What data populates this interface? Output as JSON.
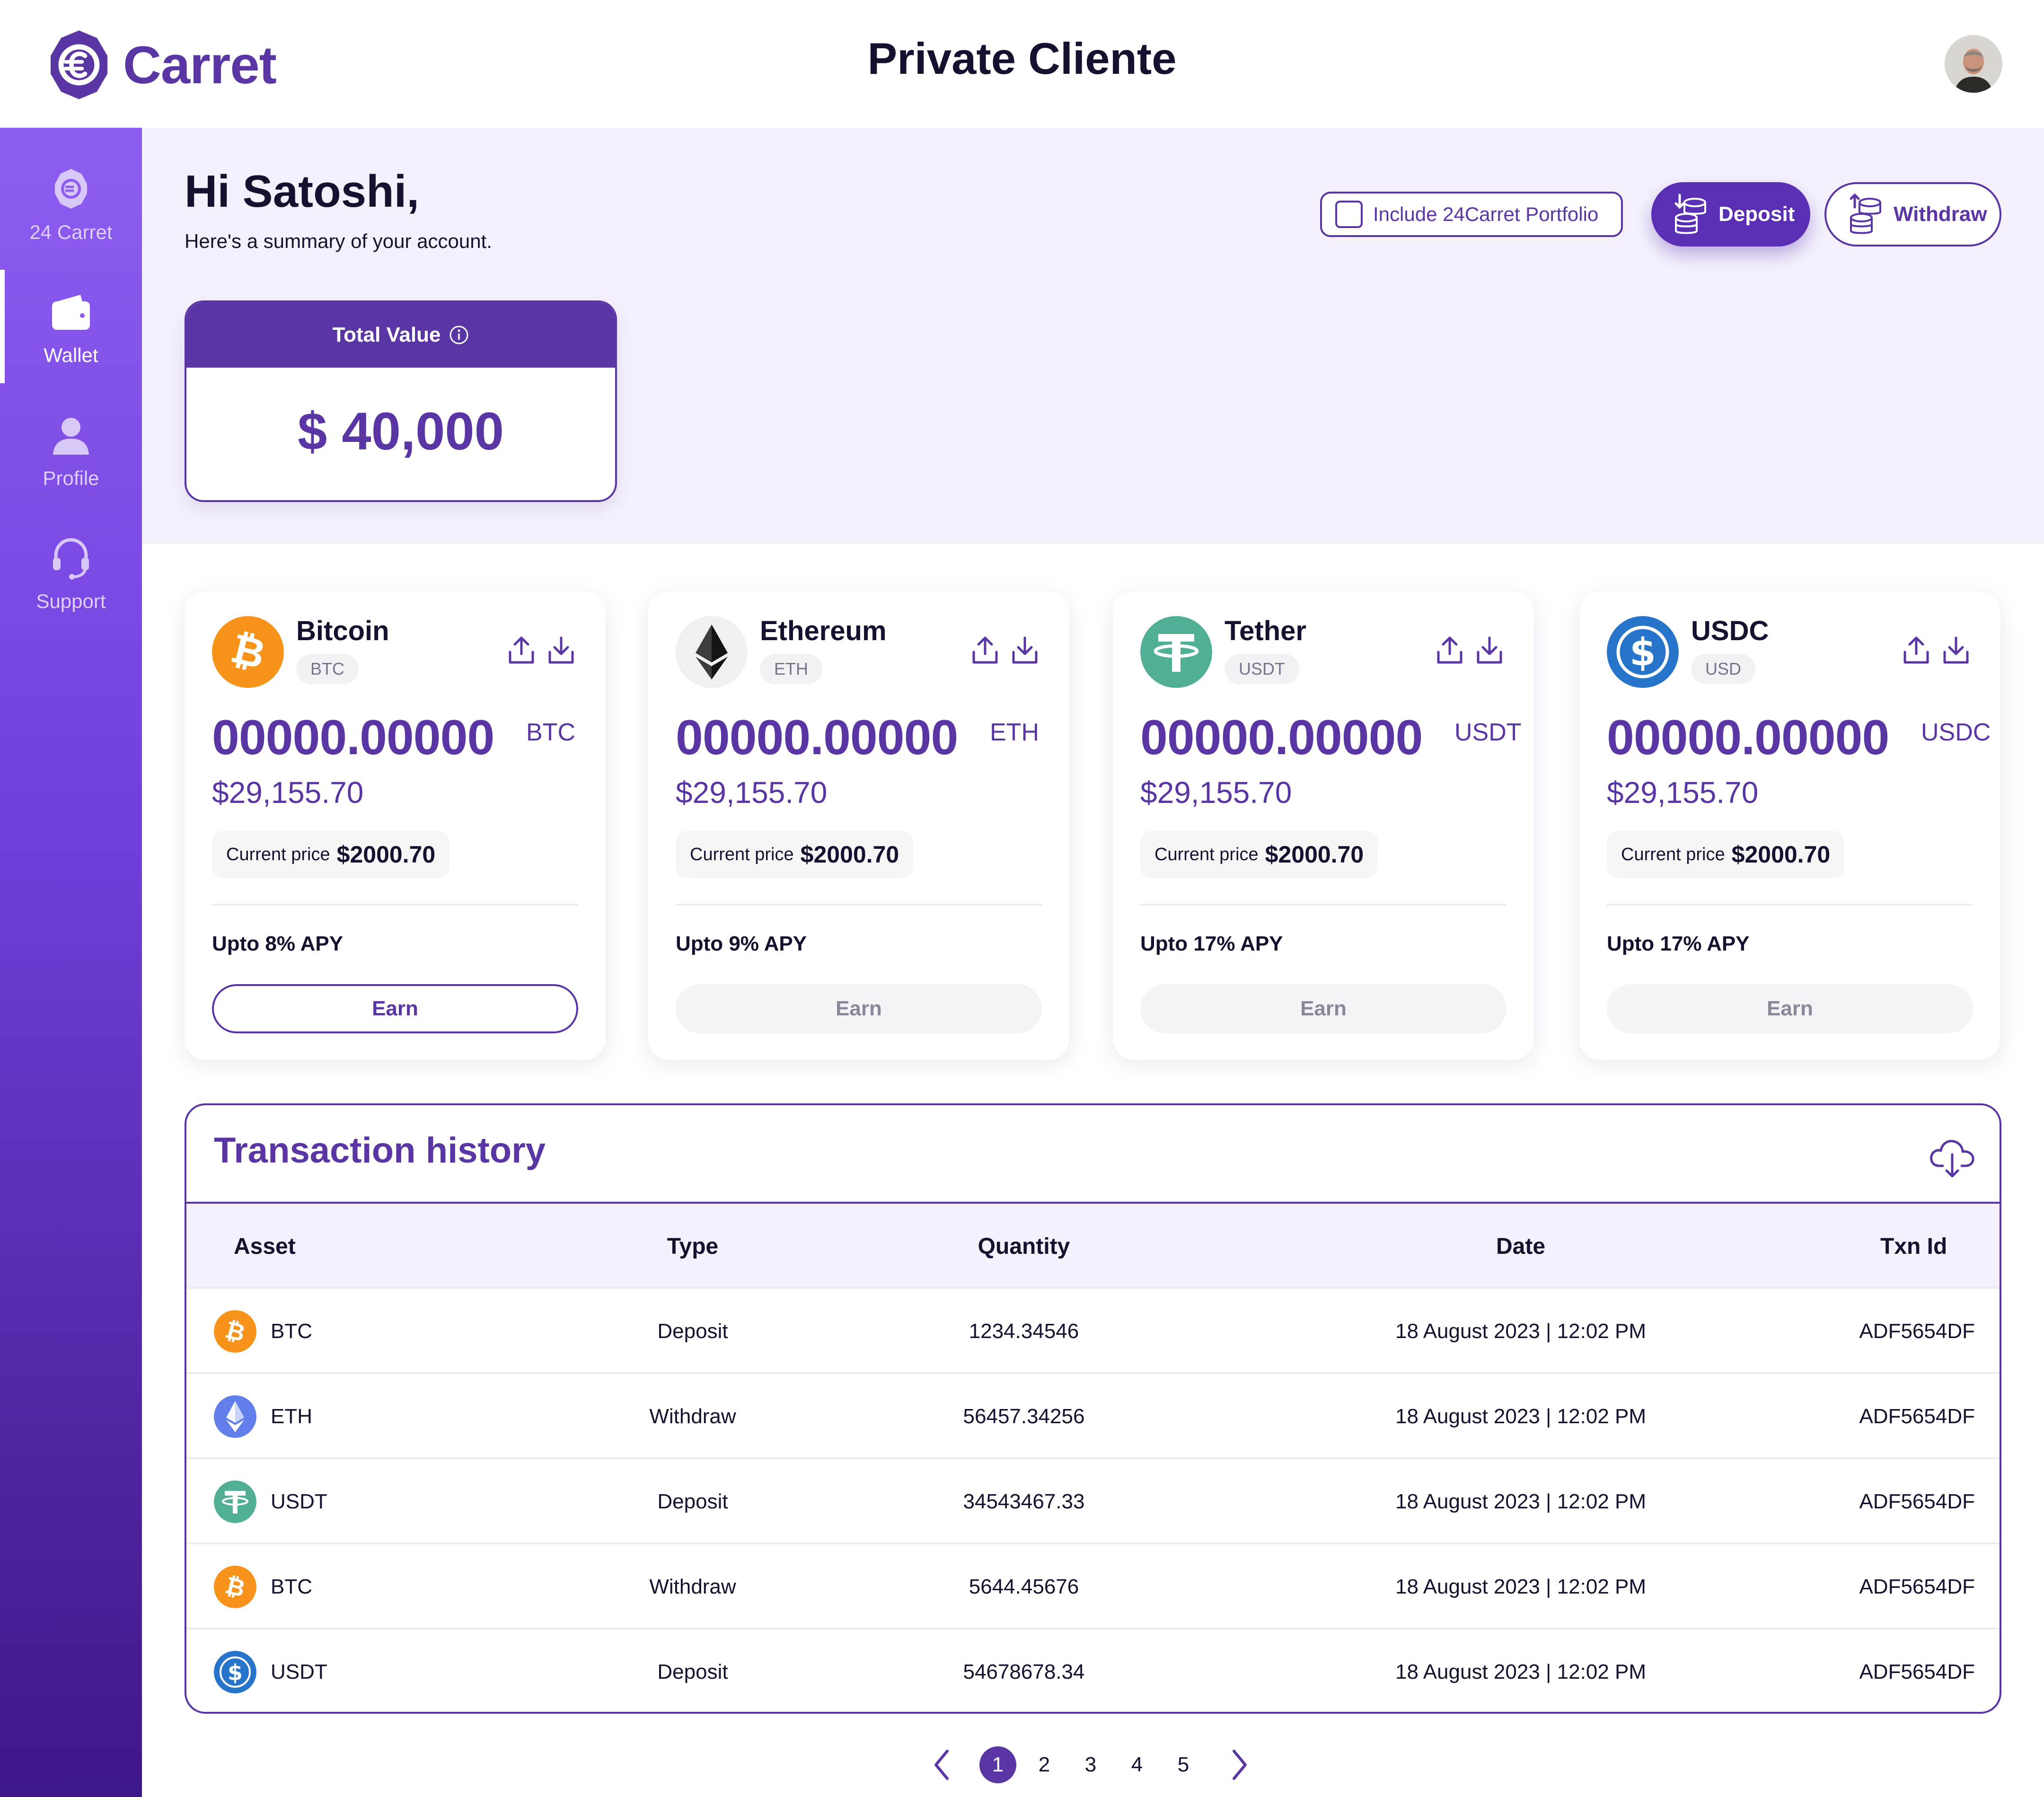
{
  "brand": {
    "name": "Carret"
  },
  "header": {
    "title": "Private Cliente",
    "avatar_alt": "user avatar"
  },
  "sidebar": {
    "items": [
      {
        "label": "24 Carret",
        "icon": "carret-coin-icon",
        "active": false
      },
      {
        "label": "Wallet",
        "icon": "wallet-icon",
        "active": true
      },
      {
        "label": "Profile",
        "icon": "user-icon",
        "active": false
      },
      {
        "label": "Support",
        "icon": "headset-icon",
        "active": false
      }
    ]
  },
  "summary": {
    "greeting": "Hi Satoshi,",
    "subtitle": "Here's a summary of your account.",
    "include_label": "Include 24Carret Portfolio",
    "include_checked": false,
    "deposit_label": "Deposit",
    "withdraw_label": "Withdraw",
    "total_label": "Total Value",
    "total_value": "$ 40,000"
  },
  "assets": [
    {
      "name": "Bitcoin",
      "ticker": "BTC",
      "qty": "00000.00000",
      "unit": "BTC",
      "usd": "$29,155.70",
      "price_label": "Current price",
      "price": "$2000.70",
      "apy": "Upto 8% APY",
      "earn": "Earn",
      "color": "#f7931a"
    },
    {
      "name": "Ethereum",
      "ticker": "ETH",
      "qty": "00000.00000",
      "unit": "ETH",
      "usd": "$29,155.70",
      "price_label": "Current price",
      "price": "$2000.70",
      "apy": "Upto 9% APY",
      "earn": "Earn",
      "color": "#3c3c3d"
    },
    {
      "name": "Tether",
      "ticker": "USDT",
      "qty": "00000.00000",
      "unit": "USDT",
      "usd": "$29,155.70",
      "price_label": "Current price",
      "price": "$2000.70",
      "apy": "Upto 17% APY",
      "earn": "Earn",
      "color": "#50af95"
    },
    {
      "name": "USDC",
      "ticker": "USD",
      "qty": "00000.00000",
      "unit": "USDC",
      "usd": "$29,155.70",
      "price_label": "Current price",
      "price": "$2000.70",
      "apy": "Upto 17% APY",
      "earn": "Earn",
      "color": "#2775ca"
    }
  ],
  "transactions": {
    "title": "Transaction history",
    "columns": [
      "Asset",
      "Type",
      "Quantity",
      "Date",
      "Txn Id"
    ],
    "rows": [
      {
        "asset": "BTC",
        "type": "Deposit",
        "quantity": "1234.34546",
        "date": "18 August 2023 | 12:02 PM",
        "txn_id": "ADF5654DF"
      },
      {
        "asset": "ETH",
        "type": "Withdraw",
        "quantity": "56457.34256",
        "date": "18 August 2023 | 12:02 PM",
        "txn_id": "ADF5654DF"
      },
      {
        "asset": "USDT",
        "type": "Deposit",
        "quantity": "34543467.33",
        "date": "18 August 2023 | 12:02 PM",
        "txn_id": "ADF5654DF"
      },
      {
        "asset": "BTC",
        "type": "Withdraw",
        "quantity": "5644.45676",
        "date": "18 August 2023 | 12:02 PM",
        "txn_id": "ADF5654DF"
      },
      {
        "asset": "USDT",
        "type": "Deposit",
        "quantity": "54678678.34",
        "date": "18 August 2023 | 12:02 PM",
        "txn_id": "ADF5654DF"
      }
    ]
  },
  "pagination": {
    "pages": [
      "1",
      "2",
      "3",
      "4",
      "5"
    ],
    "current": "1"
  },
  "colors": {
    "accent": "#5a35a4",
    "background_band": "#f4f1fc",
    "sidebar_top": "#8e5df0",
    "sidebar_bottom": "#3e178a"
  }
}
